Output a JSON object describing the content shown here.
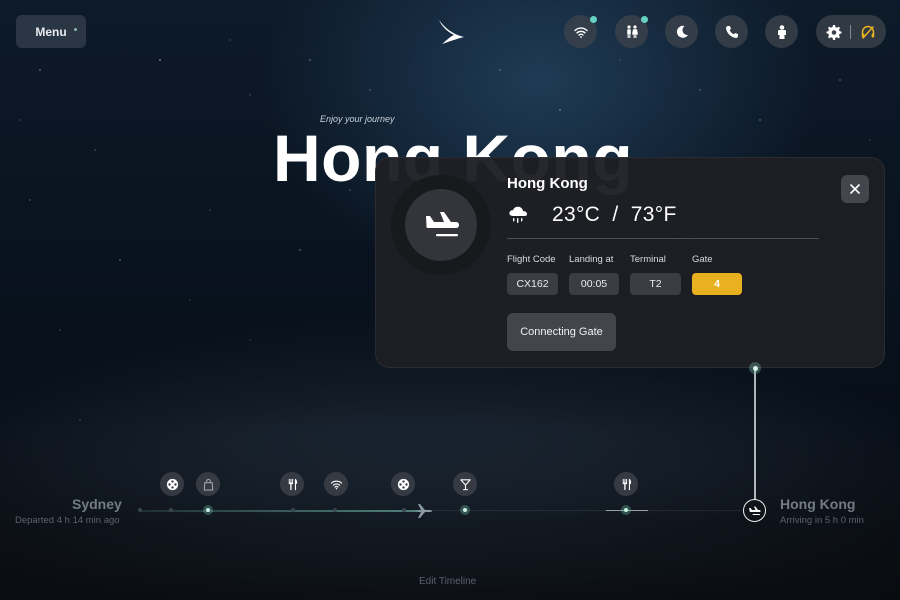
{
  "header": {
    "menu_label": "Menu"
  },
  "hero": {
    "subtitle": "Enjoy your journey",
    "destination": "Hong Kong"
  },
  "flight_card": {
    "city": "Hong Kong",
    "weather_icon": "rain-cloud-icon",
    "temperature": "23°C  /  73°F",
    "fields": [
      {
        "label": "Flight Code",
        "value": "CX162"
      },
      {
        "label": "Landing at",
        "value": "00:05"
      },
      {
        "label": "Terminal",
        "value": "T2"
      },
      {
        "label": "Gate",
        "value": "4"
      }
    ],
    "connecting_gate_label": "Connecting Gate",
    "gate_color": "#e9b020"
  },
  "timeline": {
    "origin": {
      "city": "Sydney",
      "status": "Departed 4 h 14 min ago"
    },
    "destination": {
      "city": "Hong Kong",
      "status": "Arriving in 5 h 0 min"
    },
    "edit_label": "Edit Timeline",
    "events": [
      "movie-icon",
      "shopping-bag-icon",
      "meal-icon",
      "wifi-icon",
      "movie-icon",
      "cocktail-icon",
      "meal-icon"
    ]
  },
  "colors": {
    "accent_teal": "#66d1c1",
    "gate_highlight": "#e9b020"
  }
}
